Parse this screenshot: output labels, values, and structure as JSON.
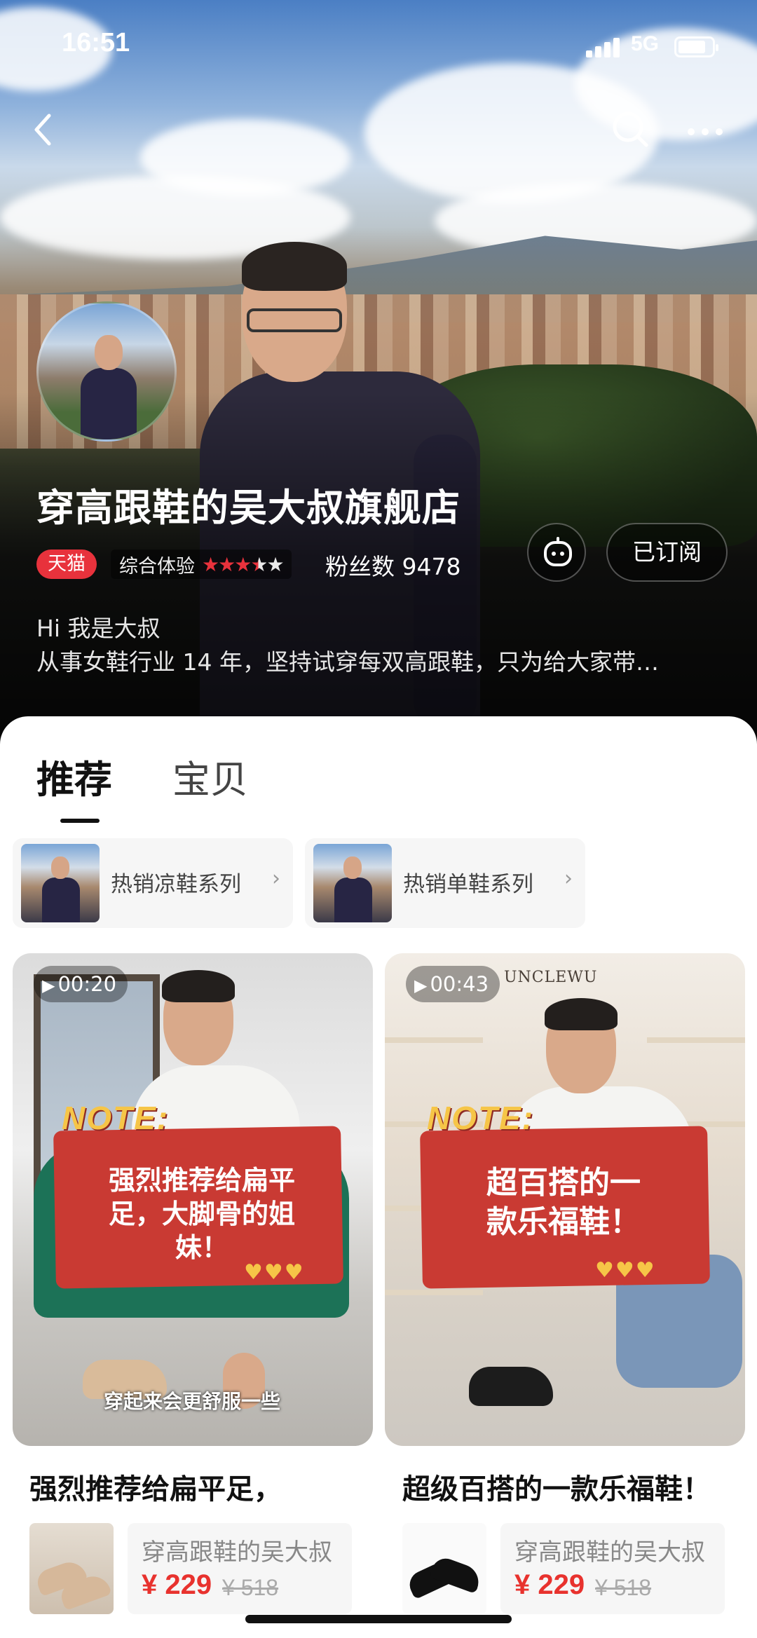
{
  "status_bar": {
    "time": "16:51",
    "network": "5G"
  },
  "store": {
    "name": "穿高跟鞋的吴大叔旗舰店",
    "badge": "天猫",
    "experience_label": "综合体验",
    "rating_stars": 3.5,
    "fans": "粉丝数 9478",
    "subscribe_label": "已订阅",
    "intro_line1": "Hi 我是大叔",
    "intro_line2": "从事女鞋行业 14 年，坚持试穿每双高跟鞋，只为给大家带…"
  },
  "tabs": [
    {
      "label": "推荐",
      "active": true
    },
    {
      "label": "宝贝",
      "active": false
    }
  ],
  "series": [
    {
      "label": "热销凉鞋系列"
    },
    {
      "label": "热销单鞋系列"
    }
  ],
  "videos": [
    {
      "duration": "00:20",
      "note_title": "NOTE:",
      "note_line1": "强烈推荐给扁平",
      "note_line2": "足，大脚骨的姐",
      "note_line3": "妹！",
      "subtitle": "穿起来会更舒服一些",
      "title": "强烈推荐给扁平足，",
      "product_shop": "穿高跟鞋的吴大叔",
      "price": "¥ 229",
      "original_price": "¥ 518"
    },
    {
      "duration": "00:43",
      "brand": "UNCLEWU",
      "note_title": "NOTE:",
      "note_line1": "超百搭的一",
      "note_line2": "款乐福鞋！",
      "title": "超级百搭的一款乐福鞋！",
      "product_shop": "穿高跟鞋的吴大叔",
      "price": "¥ 229",
      "original_price": "¥ 518"
    }
  ],
  "colors": {
    "accent": "#e8323c",
    "price": "#e8322e"
  }
}
